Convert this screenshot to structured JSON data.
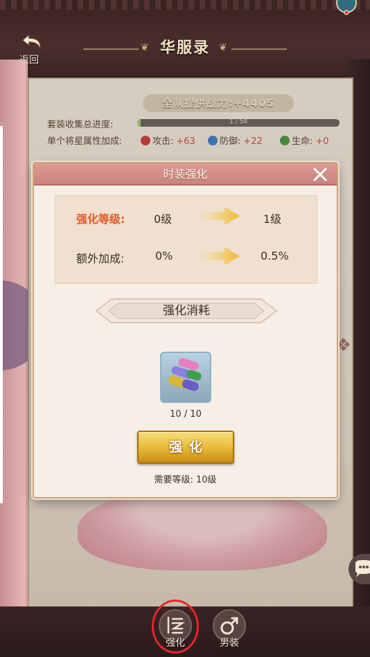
{
  "header": {
    "title": "华服录",
    "back_label": "返回"
  },
  "summary": {
    "team_power_label": "全队提供战力:+4405",
    "collection_label": "套装收集总进度:",
    "collection_progress_text": "1 / 54",
    "collection_progress_fraction": 0.0185,
    "bonus_label": "单个将星属性加成:",
    "stats": [
      {
        "label": "攻击:",
        "value": "+63",
        "icon": "attack-icon",
        "color": "#c9433b"
      },
      {
        "label": "防御:",
        "value": "+22",
        "icon": "defense-icon",
        "color": "#3f7fc4"
      },
      {
        "label": "生命:",
        "value": "+0",
        "icon": "health-icon",
        "color": "#4a9a45"
      }
    ]
  },
  "dialog": {
    "title": "时装强化",
    "level_label": "强化等级:",
    "level_from": "0级",
    "level_to": "1级",
    "bonus_label": "额外加成:",
    "bonus_from": "0%",
    "bonus_to": "0.5%",
    "cost_title": "强化消耗",
    "item_name_icon": "silk-rolls-icon",
    "item_count": "10 / 10",
    "enhance_button": "强化",
    "requirement": "需要等级: 10级"
  },
  "bottom_tabs": [
    {
      "label": "强化",
      "icon": "enhance-icon",
      "active": true
    },
    {
      "label": "男装",
      "icon": "male-icon",
      "active": false
    }
  ],
  "colors": {
    "accent_gold": "#e7b836",
    "header_red": "#c9837c",
    "highlight_ring": "#e8262a",
    "label_orange": "#e05d2f"
  }
}
